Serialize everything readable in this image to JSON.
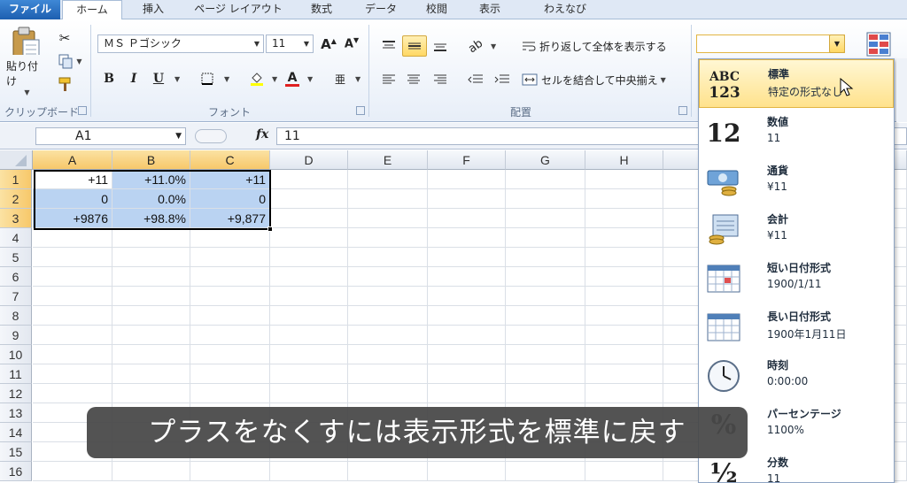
{
  "tabs": [
    {
      "label": "ファイル"
    },
    {
      "label": "ホーム"
    },
    {
      "label": "挿入"
    },
    {
      "label": "ページ レイアウト"
    },
    {
      "label": "数式"
    },
    {
      "label": "データ"
    },
    {
      "label": "校閲"
    },
    {
      "label": "表示"
    },
    {
      "label": "わえなび"
    }
  ],
  "active_tab": "ホーム",
  "ribbon": {
    "clipboard": {
      "paste_label": "貼り付け",
      "group_label": "クリップボード"
    },
    "font": {
      "font_name": "ＭＳ Ｐゴシック",
      "font_size": "11",
      "group_label": "フォント",
      "bold": "B",
      "italic": "I",
      "underline": "U"
    },
    "alignment": {
      "wrap_text_label": "折り返して全体を表示する",
      "merge_center_label": "セルを結合して中央揃え",
      "group_label": "配置"
    },
    "number": {
      "format_value": ""
    }
  },
  "formula_bar": {
    "name_box": "A1",
    "fx": "fx",
    "value": "11"
  },
  "grid": {
    "columns": [
      "A",
      "B",
      "C",
      "D",
      "E",
      "F",
      "G",
      "H"
    ],
    "rows": [
      "1",
      "2",
      "3",
      "4",
      "5",
      "6",
      "7",
      "8",
      "9",
      "10",
      "11",
      "12",
      "13",
      "14",
      "15",
      "16"
    ],
    "cells": [
      [
        "+11",
        "+11.0%",
        "+11"
      ],
      [
        "0",
        "0.0%",
        "0"
      ],
      [
        "+9876",
        "+98.8%",
        "+9,877"
      ]
    ]
  },
  "format_menu": [
    {
      "name": "標準",
      "sample": "特定の形式なし",
      "icon": "abc-123-icon"
    },
    {
      "name": "数値",
      "sample": "11",
      "icon": "number-12-icon"
    },
    {
      "name": "通貨",
      "sample": "¥11",
      "icon": "currency-icon"
    },
    {
      "name": "会計",
      "sample": "¥11",
      "icon": "accounting-icon"
    },
    {
      "name": "短い日付形式",
      "sample": "1900/1/11",
      "icon": "calendar-short-icon"
    },
    {
      "name": "長い日付形式",
      "sample": "1900年1月11日",
      "icon": "calendar-long-icon"
    },
    {
      "name": "時刻",
      "sample": "0:00:00",
      "icon": "clock-icon"
    },
    {
      "name": "パーセンテージ",
      "sample": "1100%",
      "icon": "percent-icon"
    },
    {
      "name": "分数",
      "sample": "11",
      "icon": "fraction-icon"
    }
  ],
  "format_icon_text": {
    "abc": "ABC",
    "num123": "123",
    "twelve": "12",
    "percent": "%",
    "half": "½"
  },
  "caption": "プラスをなくすには表示形式を標準に戻す",
  "colors": {
    "selection": "#bad3f2",
    "header_highlight": "#f7c86a",
    "menu_hover": "#ffe28c"
  }
}
